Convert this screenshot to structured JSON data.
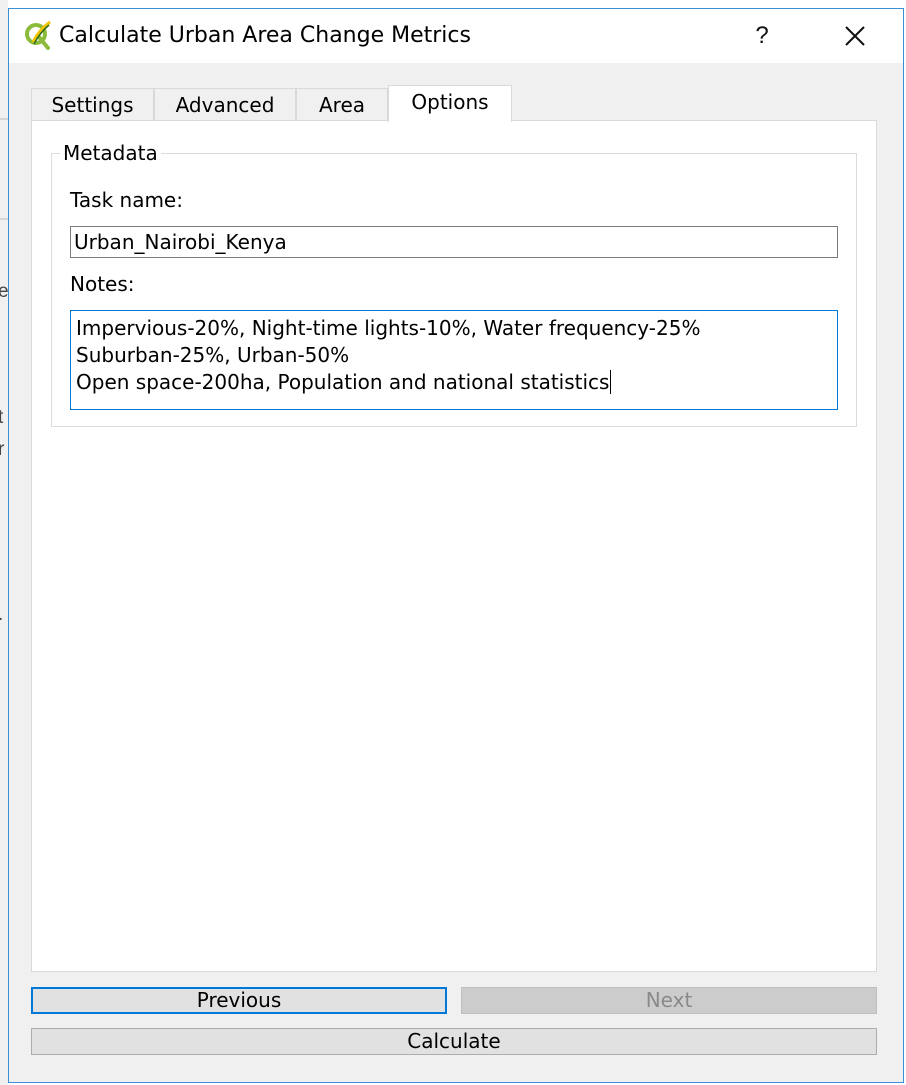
{
  "window": {
    "title": "Calculate Urban Area Change Metrics",
    "help_label": "?",
    "close_icon": "close-icon"
  },
  "tabs": [
    {
      "label": "Settings",
      "active": false
    },
    {
      "label": "Advanced",
      "active": false
    },
    {
      "label": "Area",
      "active": false
    },
    {
      "label": "Options",
      "active": true
    }
  ],
  "metadata": {
    "group_title": "Metadata",
    "task_name_label": "Task name:",
    "task_name_value": "Urban_Nairobi_Kenya",
    "notes_label": "Notes:",
    "notes_lines": [
      "Impervious-20%, Night-time lights-10%, Water frequency-25%",
      "Suburban-25%, Urban-50%",
      "Open space-200ha, Population and national statistics"
    ]
  },
  "buttons": {
    "previous": "Previous",
    "next": "Next",
    "calculate": "Calculate"
  },
  "colors": {
    "accent": "#0078d7",
    "window_bg": "#f0f0f0",
    "button_bg": "#e1e1e1",
    "disabled_bg": "#cccccc"
  }
}
